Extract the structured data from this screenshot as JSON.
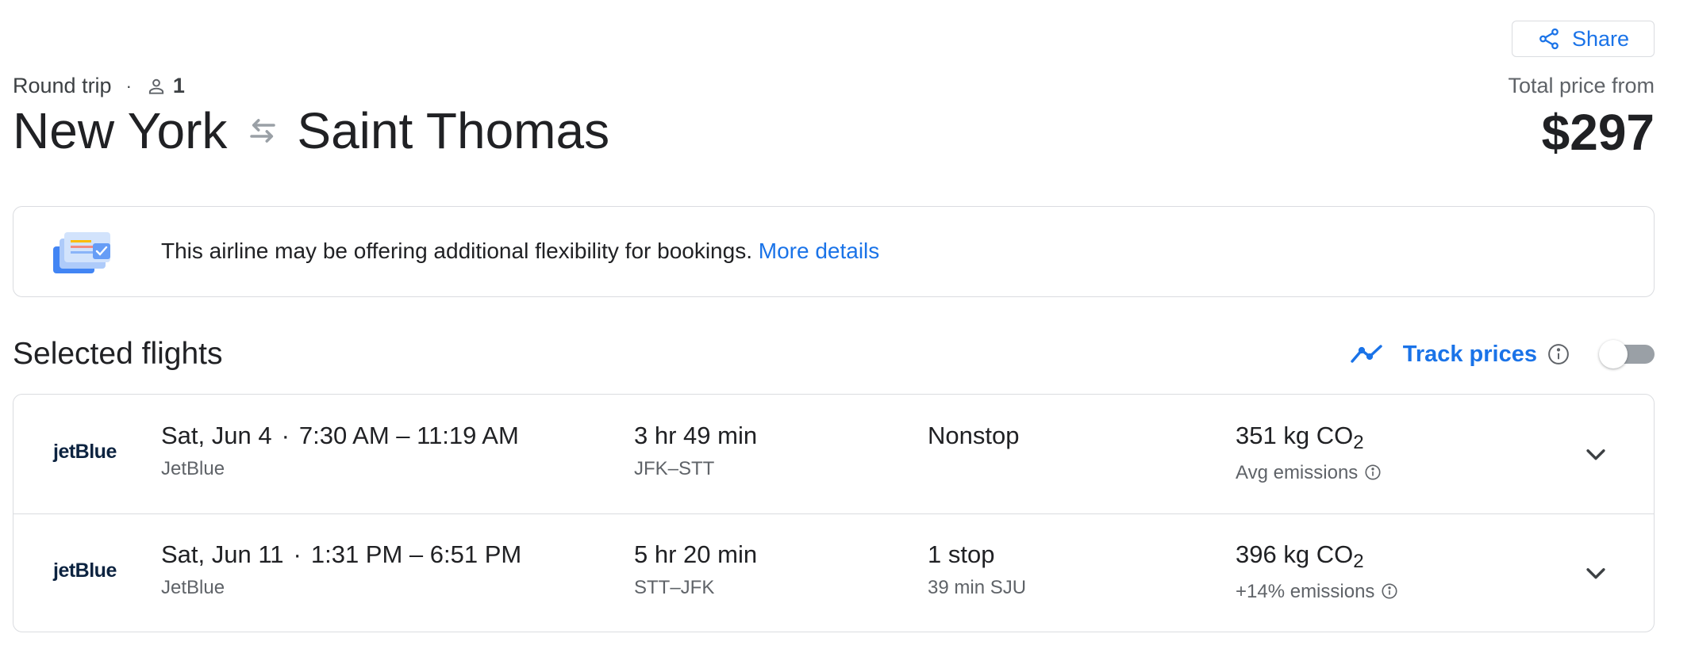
{
  "header": {
    "share_label": "Share",
    "trip_type": "Round trip",
    "passengers": "1",
    "origin": "New York",
    "destination": "Saint Thomas",
    "price_label": "Total price from",
    "price": "$297"
  },
  "banner": {
    "message": "This airline may be offering additional flexibility for bookings.",
    "link": "More details"
  },
  "selected": {
    "title": "Selected flights",
    "track_label": "Track prices",
    "track_enabled": false
  },
  "flights": [
    {
      "airline_logo": "jetBlue",
      "date": "Sat, Jun 4",
      "times": "7:30 AM – 11:19 AM",
      "airline": "JetBlue",
      "duration": "3 hr 49 min",
      "route": "JFK–STT",
      "stops": "Nonstop",
      "layover": "",
      "co2_value": "351 kg CO",
      "co2_sub": "2",
      "emissions_note": "Avg emissions"
    },
    {
      "airline_logo": "jetBlue",
      "date": "Sat, Jun 11",
      "times": "1:31 PM – 6:51 PM",
      "airline": "JetBlue",
      "duration": "5 hr 20 min",
      "route": "STT–JFK",
      "stops": "1 stop",
      "layover": "39 min SJU",
      "co2_value": "396 kg CO",
      "co2_sub": "2",
      "emissions_note": "+14% emissions"
    }
  ],
  "colors": {
    "accent": "#1a73e8",
    "text": "#202124",
    "secondary": "#5f6368",
    "border": "#dadce0",
    "toggle_off": "#9aa0a6"
  },
  "icons": {
    "share": "share-icon",
    "person": "person-icon",
    "swap": "swap-arrows-icon",
    "banner": "flexible-booking-illustration",
    "trend": "price-trend-icon",
    "info": "info-icon",
    "expand": "chevron-down-icon"
  }
}
